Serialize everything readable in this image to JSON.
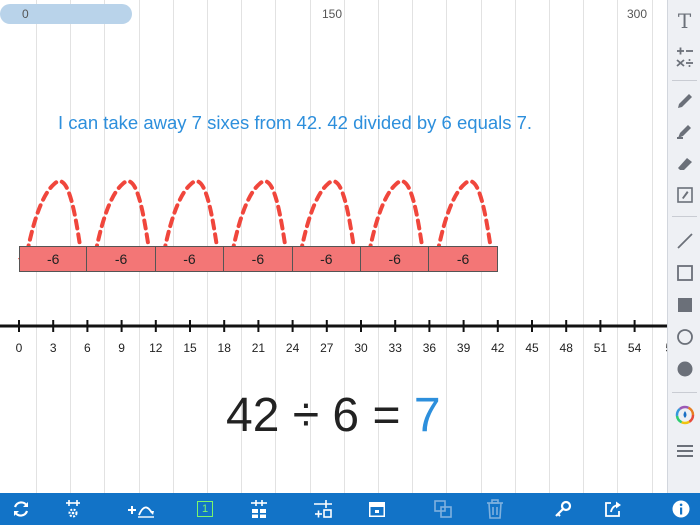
{
  "range": {
    "min_label": "0",
    "mid_label": "150",
    "max_label": "300"
  },
  "sentence": "I can take away 7 sixes from 42. 42 divided by 6 equals 7.",
  "blocks": [
    "-6",
    "-6",
    "-6",
    "-6",
    "-6",
    "-6",
    "-6"
  ],
  "number_line": {
    "ticks": [
      "0",
      "3",
      "6",
      "9",
      "12",
      "15",
      "18",
      "21",
      "24",
      "27",
      "30",
      "33",
      "36",
      "39",
      "42",
      "45",
      "48",
      "51",
      "54",
      "5"
    ]
  },
  "equation": {
    "left": "42 ÷ 6 =",
    "answer": "7"
  },
  "colors": {
    "accent": "#2d8fdc",
    "block": "#f37676",
    "arrow": "#f0463c",
    "toolbar": "#1273c7"
  },
  "right_toolbar": {
    "text_tool": "T",
    "icons": [
      "text-icon",
      "operations-icon",
      "pen-icon",
      "highlighter-icon",
      "eraser-icon",
      "note-icon",
      "line-icon",
      "square-outline-icon",
      "square-filled-icon",
      "circle-outline-icon",
      "circle-filled-icon",
      "color-picker-icon",
      "menu-icon"
    ]
  },
  "bottom_toolbar": {
    "unit_label": "1",
    "icons": [
      "refresh-icon",
      "settings-icon",
      "add-jump-icon",
      "unit-icon",
      "grid-icon",
      "add-tick-icon",
      "calendar-icon",
      "duplicate-icon",
      "trash-icon",
      "key-icon",
      "share-icon",
      "info-icon"
    ]
  }
}
